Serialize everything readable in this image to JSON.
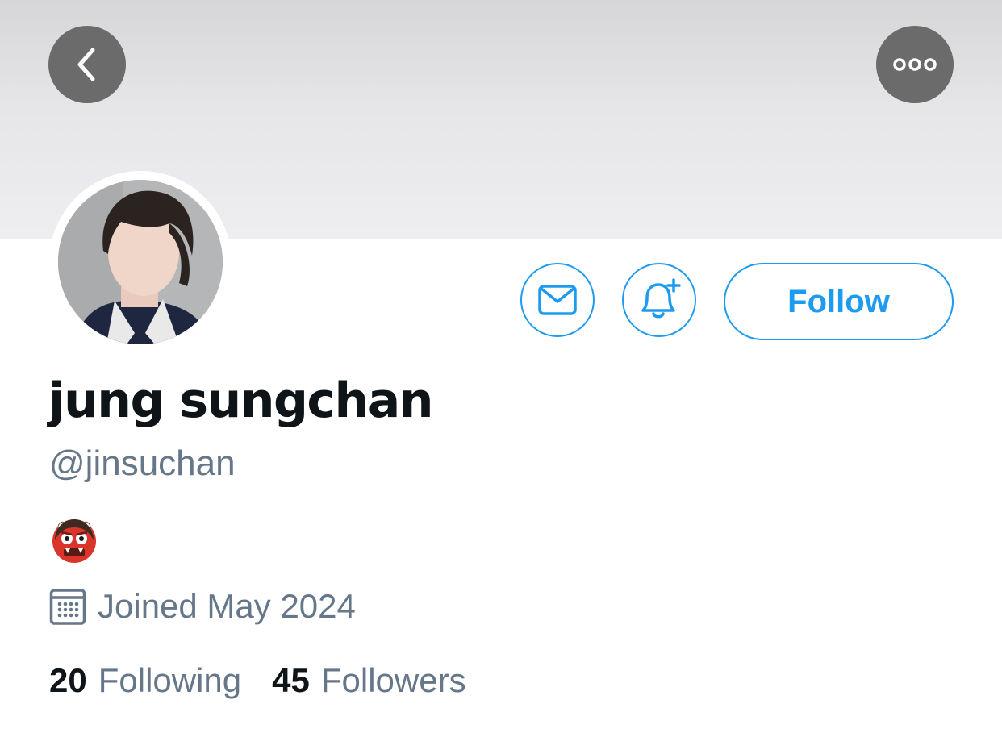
{
  "header": {
    "back_icon": "chevron-left-icon",
    "more_icon": "ellipsis-icon"
  },
  "actions": {
    "message_icon": "envelope-icon",
    "notify_icon": "bell-plus-icon",
    "follow_label": "Follow",
    "accent_color": "#1d9bf0"
  },
  "profile": {
    "display_name": "jung sungchan",
    "handle": "@jinsuchan",
    "bio_emoji_icon": "ogre-emoji-icon",
    "joined": "Joined May 2024",
    "joined_icon": "calendar-icon"
  },
  "stats": {
    "following_count": "20",
    "following_label": "Following",
    "followers_count": "45",
    "followers_label": "Followers"
  },
  "colors": {
    "text_primary": "#0f1419",
    "text_secondary": "#66778a"
  }
}
